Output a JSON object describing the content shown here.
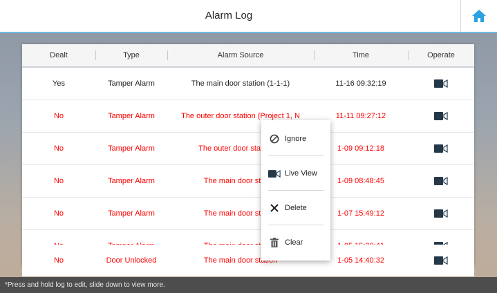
{
  "header": {
    "title": "Alarm Log",
    "home_icon": "home-icon",
    "accent_color": "#2aa3e0"
  },
  "table": {
    "columns": [
      "Dealt",
      "Type",
      "Alarm Source",
      "Time",
      "Operate"
    ],
    "rows": [
      {
        "dealt": "Yes",
        "type": "Tamper Alarm",
        "source": "The main door station (1-1-1)",
        "time": "11-16 09:32:19",
        "operate_icon": "video-camera-icon",
        "highlight": false
      },
      {
        "dealt": "No",
        "type": "Tamper Alarm",
        "source": "The outer door station (Project 1, N",
        "time": "11-11 09:27:12",
        "operate_icon": "video-camera-icon",
        "highlight": true
      },
      {
        "dealt": "No",
        "type": "Tamper Alarm",
        "source": "The outer door station (P",
        "time": "1-09 09:12:18",
        "operate_icon": "video-camera-icon",
        "highlight": true
      },
      {
        "dealt": "No",
        "type": "Tamper Alarm",
        "source": "The main door station",
        "time": "1-09 08:48:45",
        "operate_icon": "video-camera-icon",
        "highlight": true
      },
      {
        "dealt": "No",
        "type": "Tamper Alarm",
        "source": "The main door station",
        "time": "1-07 15:49:12",
        "operate_icon": "video-camera-icon",
        "highlight": true
      },
      {
        "dealt": "No",
        "type": "Tamper Alarm",
        "source": "The main door station",
        "time": "1-05 15:20:41",
        "operate_icon": "video-camera-icon",
        "highlight": true
      },
      {
        "dealt": "No",
        "type": "Door Unlocked",
        "source": "The main door station",
        "time": "1-05 14:40:32",
        "operate_icon": "video-camera-icon",
        "highlight": true
      }
    ]
  },
  "context_menu": {
    "items": [
      {
        "label": "Ignore",
        "icon": "ban-icon"
      },
      {
        "label": "Live View",
        "icon": "video-camera-icon"
      },
      {
        "label": "Delete",
        "icon": "close-icon"
      },
      {
        "label": "Clear",
        "icon": "trash-icon"
      }
    ]
  },
  "footer": {
    "hint": "*Press and hold log to edit, slide down to view more."
  },
  "colors": {
    "alert_text": "#ff0000",
    "normal_text": "#222222",
    "icon_dark": "#253848"
  }
}
